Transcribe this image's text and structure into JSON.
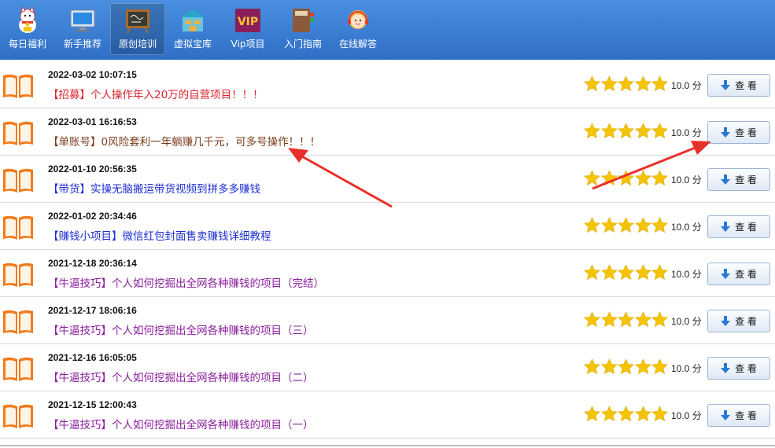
{
  "nav": {
    "items": [
      {
        "label": "每日福利",
        "icon": "lucky-cat-icon"
      },
      {
        "label": "新手推荐",
        "icon": "monitor-icon"
      },
      {
        "label": "原创培训",
        "icon": "chalkboard-icon"
      },
      {
        "label": "虚拟宝库",
        "icon": "warehouse-icon"
      },
      {
        "label": "Vip项目",
        "icon": "vip-badge-icon",
        "icon_text": "VIP"
      },
      {
        "label": "入门指南",
        "icon": "guide-book-icon"
      },
      {
        "label": "在线解答",
        "icon": "support-agent-icon"
      }
    ],
    "active_index": 2
  },
  "rows": [
    {
      "date": "2022-03-02 10:07:15",
      "title": "【招募】个人操作年入20万的自营项目！！！",
      "color": "#d9232e",
      "stars": 5,
      "score": "10.0 分",
      "button": "查 看"
    },
    {
      "date": "2022-03-01 16:16:53",
      "title": "【单账号】0风险套利一年躺赚几千元，可多号操作！！！",
      "color": "#7a3c1c",
      "stars": 5,
      "score": "10.0 分",
      "button": "查 看"
    },
    {
      "date": "2022-01-10 20:56:35",
      "title": "【带货】实操无脑搬运带货视频到拼多多赚钱",
      "color": "#1c2fd0",
      "stars": 5,
      "score": "10.0 分",
      "button": "查 看"
    },
    {
      "date": "2022-01-02 20:34:46",
      "title": "【赚钱小项目】微信红包封面售卖赚钱详细教程",
      "color": "#1c2fd0",
      "stars": 5,
      "score": "10.0 分",
      "button": "查 看"
    },
    {
      "date": "2021-12-18 20:36:14",
      "title": "【牛逼技巧】个人如何挖掘出全网各种赚钱的项目（完结）",
      "color": "#8a1e9c",
      "stars": 5,
      "score": "10.0 分",
      "button": "查 看"
    },
    {
      "date": "2021-12-17 18:06:16",
      "title": "【牛逼技巧】个人如何挖掘出全网各种赚钱的项目（三）",
      "color": "#8a1e9c",
      "stars": 5,
      "score": "10.0 分",
      "button": "查 看"
    },
    {
      "date": "2021-12-16 16:05:05",
      "title": "【牛逼技巧】个人如何挖掘出全网各种赚钱的项目（二）",
      "color": "#8a1e9c",
      "stars": 5,
      "score": "10.0 分",
      "button": "查 看"
    },
    {
      "date": "2021-12-15 12:00:43",
      "title": "【牛逼技巧】个人如何挖掘出全网各种赚钱的项目（一）",
      "color": "#8a1e9c",
      "stars": 5,
      "score": "10.0 分",
      "button": "查 看"
    }
  ],
  "colors": {
    "topbar": "#3a7fd5",
    "star": "#f5c400",
    "arrow": "#e8302a",
    "book": "#f27a1a"
  }
}
